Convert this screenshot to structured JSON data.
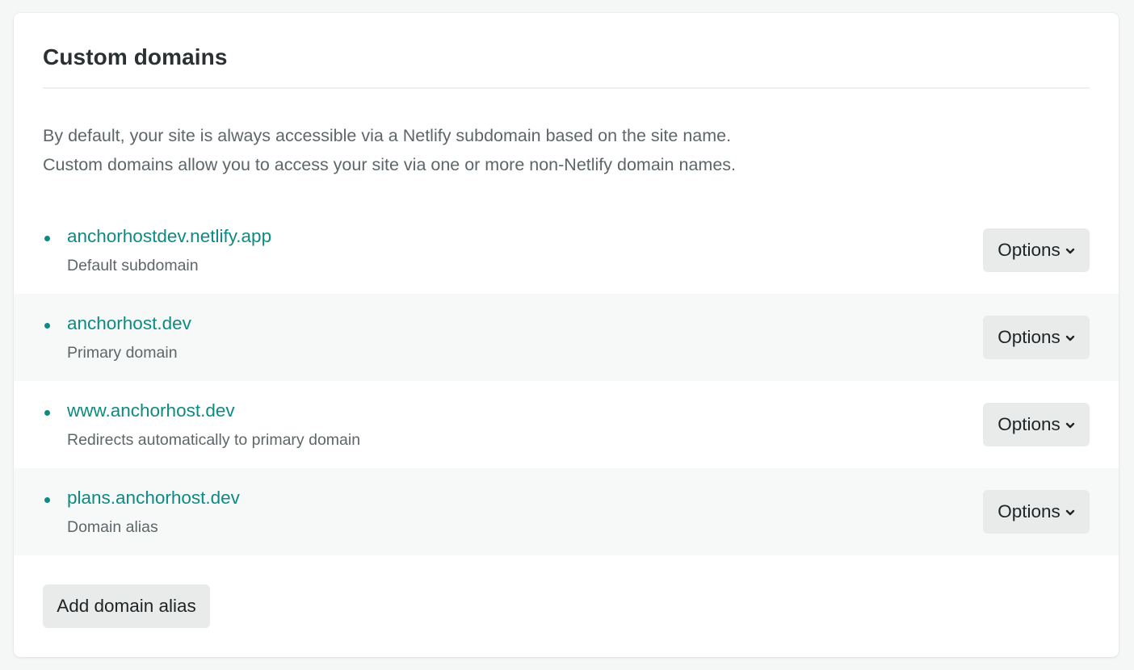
{
  "section": {
    "title": "Custom domains",
    "description_line1": "By default, your site is always accessible via a Netlify subdomain based on the site name.",
    "description_line2": "Custom domains allow you to access your site via one or more non-Netlify domain names."
  },
  "domains": [
    {
      "name": "anchorhostdev.netlify.app",
      "subtitle": "Default subdomain",
      "options_label": "Options"
    },
    {
      "name": "anchorhost.dev",
      "subtitle": "Primary domain",
      "options_label": "Options"
    },
    {
      "name": "www.anchorhost.dev",
      "subtitle": "Redirects automatically to primary domain",
      "options_label": "Options"
    },
    {
      "name": "plans.anchorhost.dev",
      "subtitle": "Domain alias",
      "options_label": "Options"
    }
  ],
  "actions": {
    "add_alias_label": "Add domain alias"
  },
  "icons": {
    "bullet": "bullet-dot-icon",
    "options_chevron": "chevron-down-icon"
  },
  "colors": {
    "accent": "#0d8a82",
    "button_bg": "#e9ebeb",
    "alt_row_bg": "#f7f9f9"
  }
}
